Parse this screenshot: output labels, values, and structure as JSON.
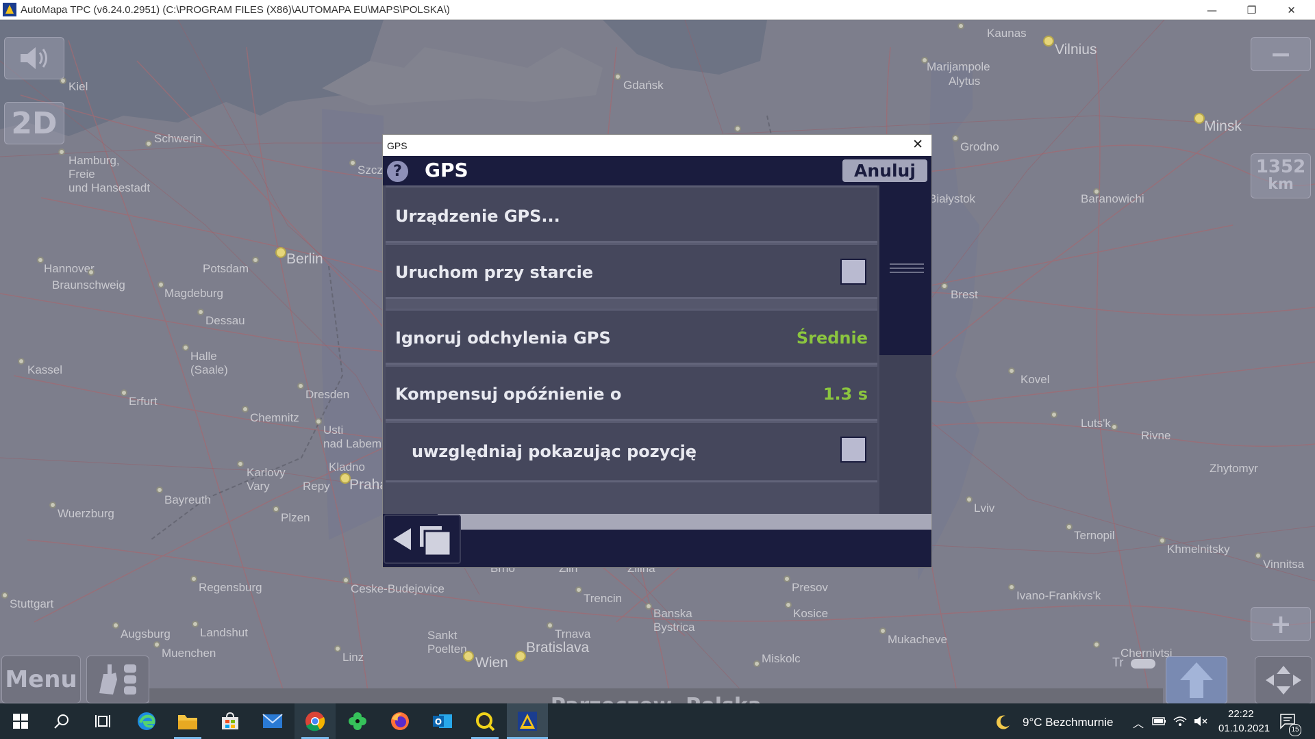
{
  "window": {
    "title": "AutoMapa TPC (v6.24.0.2951) (C:\\PROGRAM FILES (X86)\\AUTOMAPA EU\\MAPS\\POLSKA\\)",
    "minimize_glyph": "—",
    "restore_glyph": "❐",
    "close_glyph": "✕"
  },
  "map": {
    "places": [
      "Kaunas",
      "Vilnius",
      "Kiel",
      "Gdańsk",
      "Marijampole",
      "Alytus",
      "Minsk",
      "Schwerin",
      "Hamburg,",
      "Freie",
      "und Hansestadt",
      "Szcz",
      "Grodno",
      "Białystok",
      "Baranowichi",
      "Hannover",
      "Potsdam",
      "Berlin",
      "Braunschweig",
      "Magdeburg",
      "Brest",
      "Dessau",
      "Halle",
      "(Saale)",
      "Kassel",
      "Kovel",
      "Dresden",
      "Erfurt",
      "Chemnitz",
      "Usti",
      "nad Labem",
      "Luts'k",
      "Rivne",
      "Kladno",
      "Karlovy",
      "Vary",
      "Repy",
      "Praha",
      "Zhytomyr",
      "Bayreuth",
      "Wuerzburg",
      "Plzen",
      "Lviv",
      "Ternopil",
      "Khmelnitsky",
      "Vinnitsa",
      "Brno",
      "Zlin",
      "Zilina",
      "Presov",
      "Regensburg",
      "Ceske-Budejovice",
      "Trencin",
      "Ivano-Frankivs'k",
      "Stuttgart",
      "Banska",
      "Bystrica",
      "Kosice",
      "Augsburg",
      "Landshut",
      "Sankt",
      "Poelten",
      "Trnava",
      "Mukacheve",
      "Muenchen",
      "Linz",
      "Wien",
      "Bratislava",
      "Miskolc",
      "Chernivtsi"
    ],
    "volume_icon": "speaker-icon",
    "view_mode_label": "2D",
    "zoom_out_label": "−",
    "zoom_in_label": "+",
    "distance_value": "1352",
    "distance_unit": "km",
    "menu_label": "Menu",
    "current_location": "Parzęczew, Polska",
    "traffic_label": "Tr"
  },
  "dialog": {
    "window_title": "GPS",
    "title": "GPS",
    "help_label": "?",
    "cancel_label": "Anuluj",
    "rows": [
      {
        "label": "Urządzenie GPS...",
        "value": ""
      },
      {
        "label": "Uruchom przy starcie",
        "value": ""
      },
      {
        "label": "Ignoruj odchylenia GPS",
        "value": "Średnie"
      },
      {
        "label": "Kompensuj opóźnienie o",
        "value": "1.3 s"
      },
      {
        "label": "uwzględniaj pokazując pozycję",
        "value": ""
      }
    ],
    "row_checkbox_states": [
      false,
      false
    ],
    "value_color": "#8bc53f"
  },
  "taskbar": {
    "weather": "9°C  Bezchmurnie",
    "time": "22:22",
    "date": "01.10.2021",
    "notification_count": "15"
  }
}
